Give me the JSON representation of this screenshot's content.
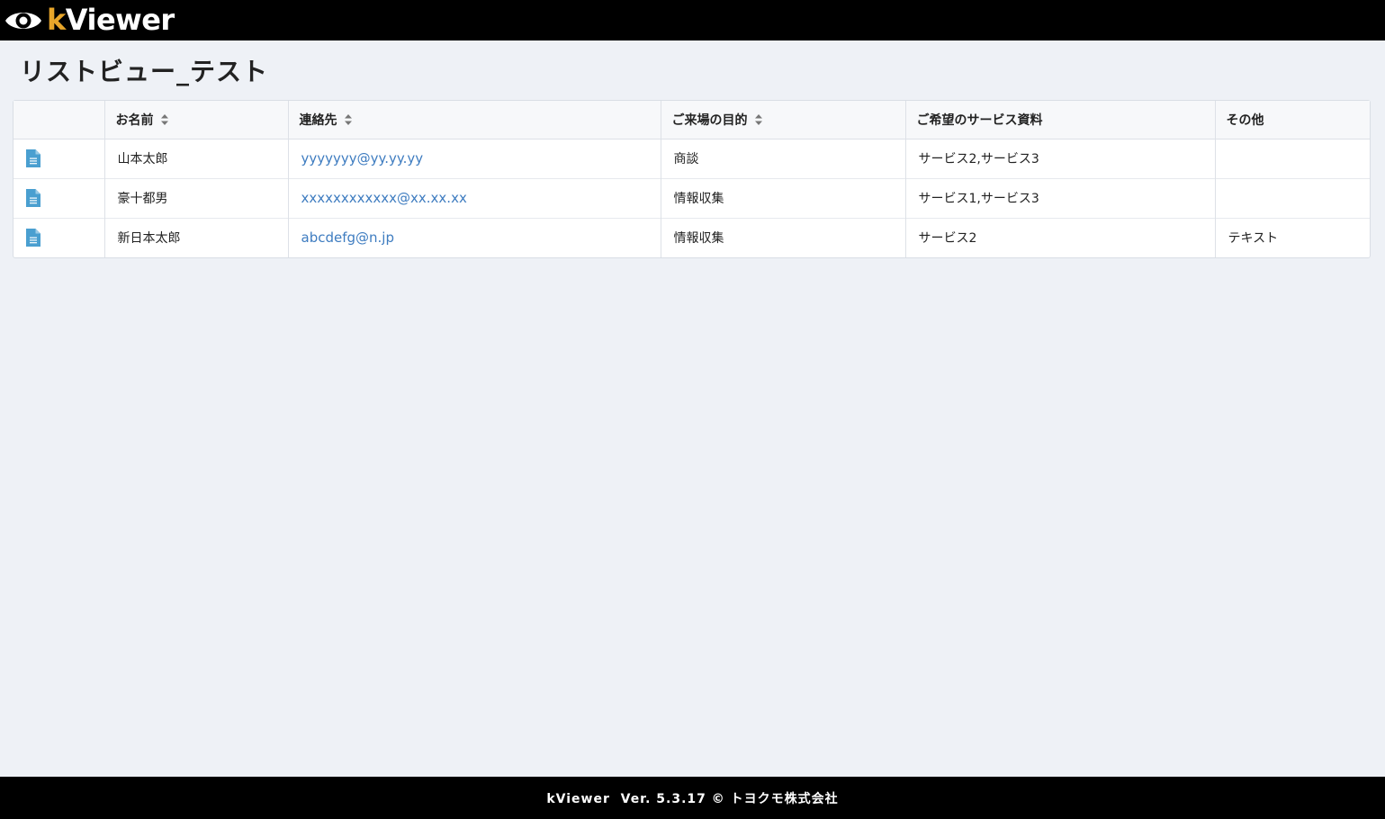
{
  "app": {
    "logo_k": "k",
    "logo_rest": "Viewer"
  },
  "page": {
    "title": "リストビュー_テスト"
  },
  "table": {
    "columns": [
      {
        "label": "",
        "sortable": false
      },
      {
        "label": "お名前",
        "sortable": true
      },
      {
        "label": "連絡先",
        "sortable": true
      },
      {
        "label": "ご来場の目的",
        "sortable": true
      },
      {
        "label": "ご希望のサービス資料",
        "sortable": false
      },
      {
        "label": "その他",
        "sortable": false
      }
    ],
    "rows": [
      {
        "name": "山本太郎",
        "contact": "yyyyyyy@yy.yy.yy",
        "purpose": "商談",
        "services": "サービス2,サービス3",
        "other": ""
      },
      {
        "name": "豪十都男",
        "contact": "xxxxxxxxxxxx@xx.xx.xx",
        "purpose": "情報収集",
        "services": "サービス1,サービス3",
        "other": ""
      },
      {
        "name": "新日本太郎",
        "contact": "abcdefg@n.jp",
        "purpose": "情報収集",
        "services": "サービス2",
        "other": "テキスト"
      }
    ]
  },
  "footer": {
    "text": "kViewer  Ver. 5.3.17 © トヨクモ株式会社"
  },
  "icons": {
    "logo": "eye-icon",
    "sort": "sort-icon",
    "detail": "document-icon"
  },
  "colors": {
    "header_bg": "#000000",
    "accent": "#e8a62a",
    "link": "#3e7cc0",
    "doc_icon": "#4a9fd0",
    "page_bg": "#eef1f6"
  }
}
